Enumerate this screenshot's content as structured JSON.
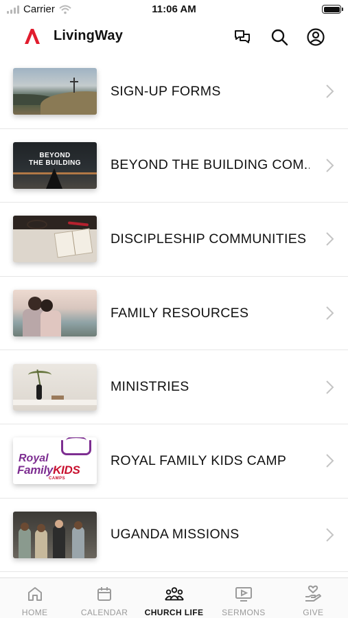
{
  "status_bar": {
    "carrier": "Carrier",
    "time": "11:06 AM",
    "battery_level": 1.0
  },
  "header": {
    "app_title": "LivingWay",
    "brand_color": "#e11d2e",
    "icons": [
      "chat-icon",
      "search-icon",
      "account-icon"
    ]
  },
  "list": {
    "items": [
      {
        "label": "SIGN-UP FORMS",
        "thumb": "mountain-cross"
      },
      {
        "label": "BEYOND THE BUILDING COM...",
        "thumb": "beyond-the-building",
        "thumb_text": "BEYOND\nTHE BUILDING"
      },
      {
        "label": "DISCIPLESHIP COMMUNITIES",
        "thumb": "bible-coffee"
      },
      {
        "label": "FAMILY RESOURCES",
        "thumb": "mother-daughter"
      },
      {
        "label": "MINISTRIES",
        "thumb": "plant-vase"
      },
      {
        "label": "ROYAL FAMILY KIDS CAMP",
        "thumb": "rfk-logo",
        "thumb_text": {
          "line1": "Royal",
          "line2a": "Family",
          "line2b": "KIDS",
          "line3": "CAMPS"
        }
      },
      {
        "label": "UGANDA MISSIONS",
        "thumb": "group-photo"
      }
    ]
  },
  "tab_bar": {
    "tabs": [
      {
        "label": "HOME",
        "icon": "home-icon",
        "active": false
      },
      {
        "label": "CALENDAR",
        "icon": "calendar-icon",
        "active": false
      },
      {
        "label": "CHURCH LIFE",
        "icon": "people-icon",
        "active": true
      },
      {
        "label": "SERMONS",
        "icon": "video-icon",
        "active": false
      },
      {
        "label": "GIVE",
        "icon": "give-icon",
        "active": false
      }
    ]
  }
}
